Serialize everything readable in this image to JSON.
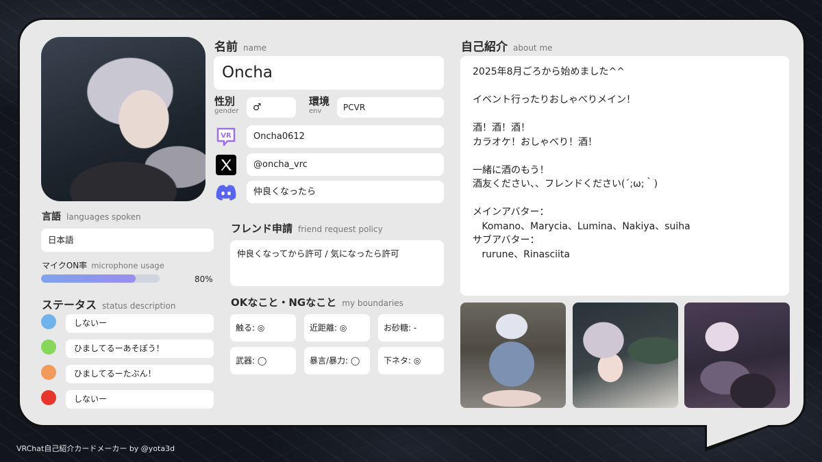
{
  "name_section": {
    "label_ja": "名前",
    "label_en": "name",
    "value": "Oncha"
  },
  "gender": {
    "label_ja": "性別",
    "label_en": "gender",
    "value": "♂"
  },
  "env": {
    "label_ja": "環境",
    "label_en": "env",
    "value": "PCVR"
  },
  "vrchat_id": "Oncha0612",
  "x_handle": "@oncha_vrc",
  "discord": "仲良くなったら",
  "friend_request": {
    "label_ja": "フレンド申請",
    "label_en": "friend request policy",
    "value": "仲良くなってから許可 / 気になったら許可"
  },
  "boundaries": {
    "label_ja": "OKなこと・NGなこと",
    "label_en": "my boundaries",
    "items": [
      "触る: ◎",
      "近距離: ◎",
      "お砂糖: -",
      "武器: ◯",
      "暴言/暴力: ◯",
      "下ネタ: ◎"
    ]
  },
  "languages": {
    "label_ja": "言語",
    "label_en": "languages spoken",
    "value": "日本語"
  },
  "mic": {
    "label_ja": "マイクON率",
    "label_en": "microphone usage",
    "percent_text": "80%",
    "fraction": 0.8
  },
  "status": {
    "label_ja": "ステータス",
    "label_en": "status description",
    "items": [
      {
        "color": "#6fb3ea",
        "text": "しないー"
      },
      {
        "color": "#86d75a",
        "text": "ひましてるーあそぼう！"
      },
      {
        "color": "#f39a5a",
        "text": "ひましてるーたぶん！"
      },
      {
        "color": "#e8352b",
        "text": "しないー"
      }
    ]
  },
  "about": {
    "label_ja": "自己紹介",
    "label_en": "about me",
    "text": "2025年8月ごろから始めました^^\n\nイベント行ったりおしゃべりメイン！\n\n酒！酒！酒！\nカラオケ！おしゃべり！酒！\n\n一緒に酒のもう！\n酒友ください、、フレンドください(´;ω;｀)\n\nメインアバター：\n   Komano、Marycia、Lumina、Nakiya、suiha\nサブアバター：\n   rurune、Rinasciita"
  },
  "icons": {
    "vrchat": "vrchat-icon",
    "x": "x-logo-icon",
    "discord": "discord-icon"
  },
  "colors": {
    "mic_bar": "#8a9ef0",
    "discord": "#5865f2",
    "vrchat": "#9c6ef0"
  },
  "footer": "VRChat自己紹介カードメーカー by @yota3d"
}
